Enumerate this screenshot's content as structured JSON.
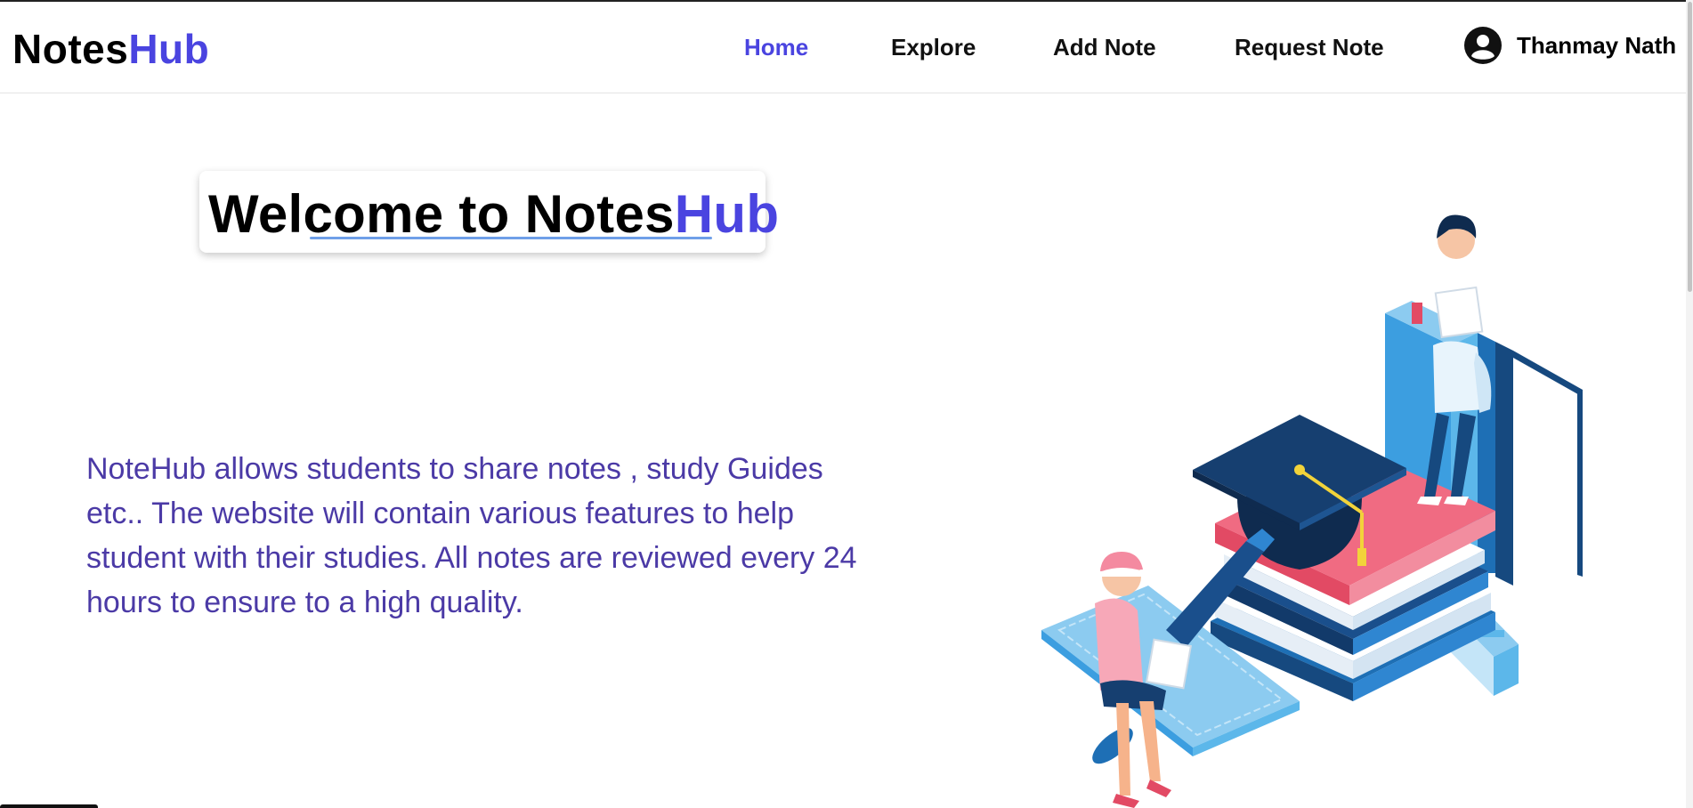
{
  "brand": {
    "name_part1": "Notes",
    "name_part2": "Hub"
  },
  "nav": {
    "items": [
      {
        "label": "Home",
        "active": true
      },
      {
        "label": "Explore",
        "active": false
      },
      {
        "label": "Add Note",
        "active": false
      },
      {
        "label": "Request Note",
        "active": false
      }
    ],
    "user": {
      "name": "Thanmay Nath",
      "icon": "user-circle-icon"
    }
  },
  "hero": {
    "title_part1": "Welcome to Notes",
    "title_part2": "Hub",
    "description": "NoteHub allows students to share notes , study Guides etc.. The website will contain various features to help student with their studies. All notes are reviewed every 24 hours to ensure to a high quality.",
    "illustration": "students-studying-books-graduation-cap-illustration"
  },
  "colors": {
    "accent": "#4a44e0",
    "description_text": "#4b3aa6",
    "underline": "#6f9fe8"
  }
}
